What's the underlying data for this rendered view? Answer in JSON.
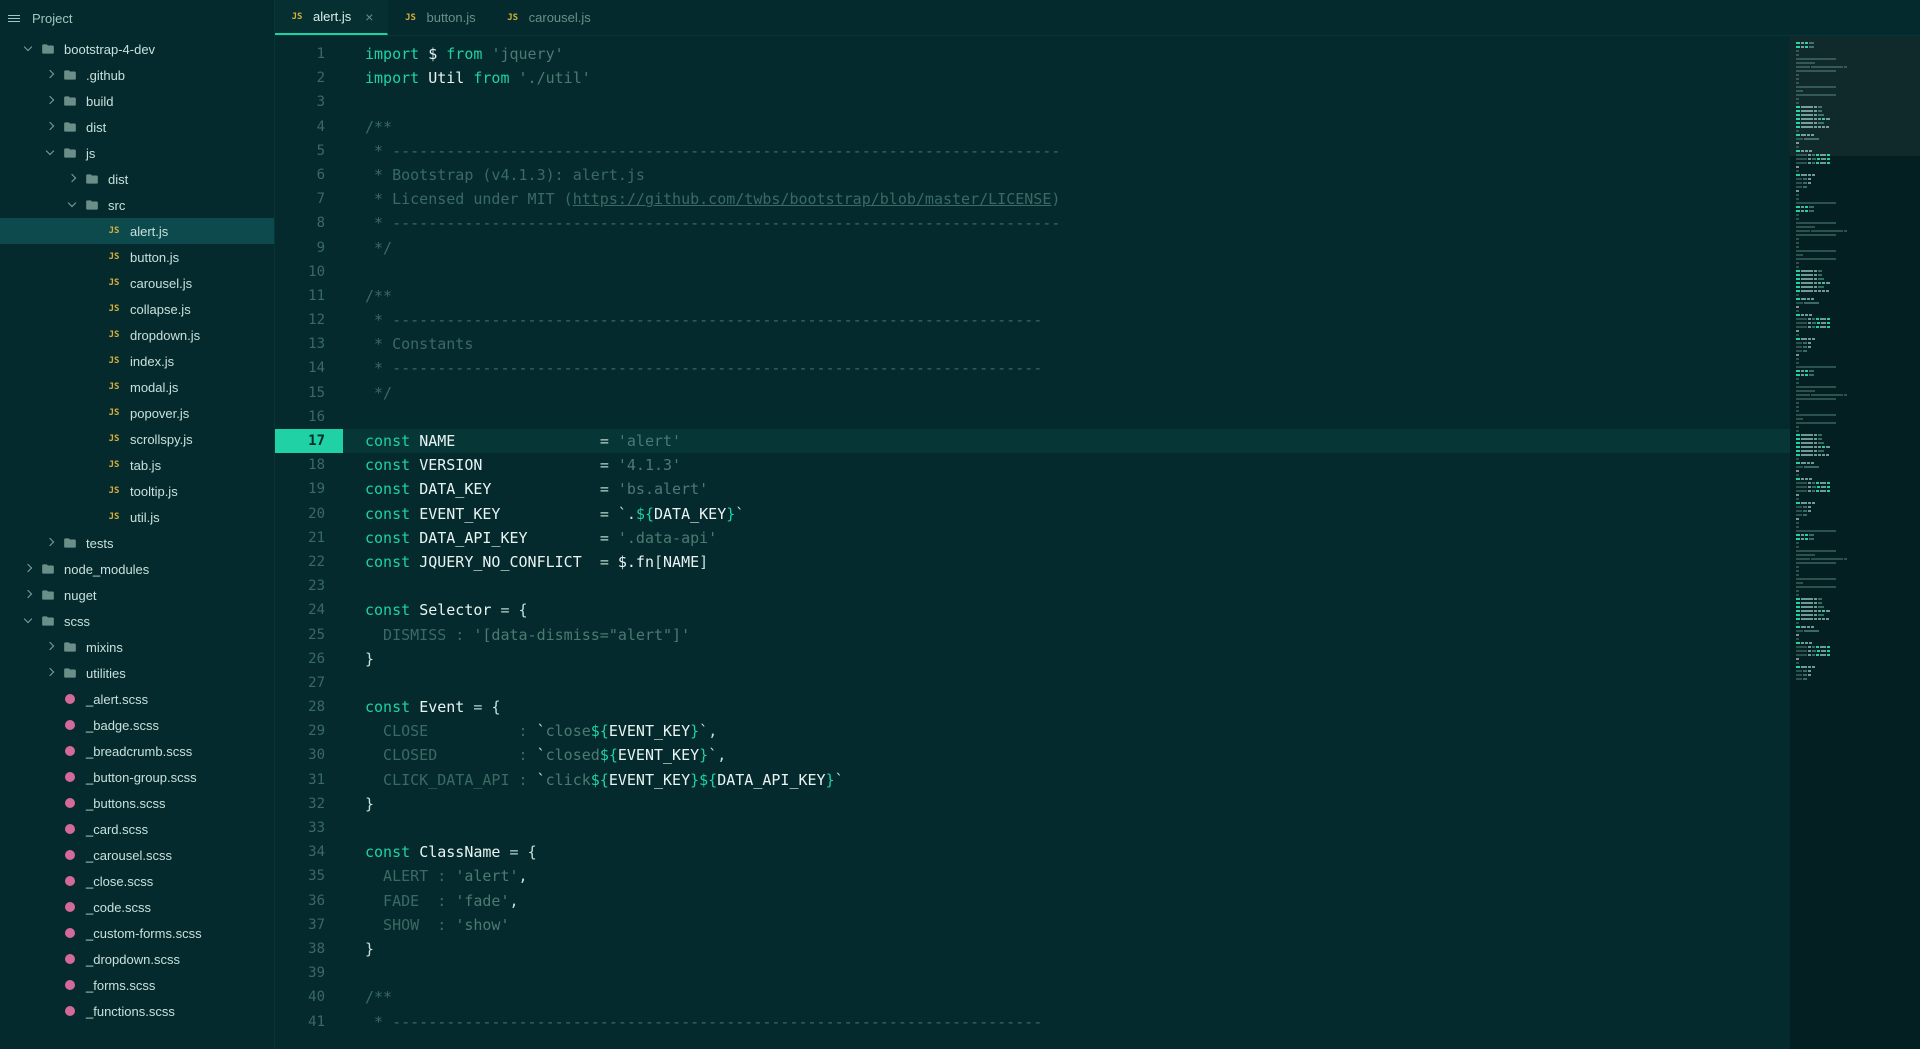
{
  "sidebar": {
    "header": "Project",
    "tree": [
      {
        "depth": 0,
        "kind": "folder",
        "expanded": true,
        "label": "bootstrap-4-dev"
      },
      {
        "depth": 1,
        "kind": "folder",
        "expanded": false,
        "label": ".github"
      },
      {
        "depth": 1,
        "kind": "folder",
        "expanded": false,
        "label": "build"
      },
      {
        "depth": 1,
        "kind": "folder",
        "expanded": false,
        "label": "dist"
      },
      {
        "depth": 1,
        "kind": "folder",
        "expanded": true,
        "label": "js"
      },
      {
        "depth": 2,
        "kind": "folder",
        "expanded": false,
        "label": "dist"
      },
      {
        "depth": 2,
        "kind": "folder",
        "expanded": true,
        "label": "src"
      },
      {
        "depth": 3,
        "kind": "js",
        "label": "alert.js",
        "selected": true
      },
      {
        "depth": 3,
        "kind": "js",
        "label": "button.js"
      },
      {
        "depth": 3,
        "kind": "js",
        "label": "carousel.js"
      },
      {
        "depth": 3,
        "kind": "js",
        "label": "collapse.js"
      },
      {
        "depth": 3,
        "kind": "js",
        "label": "dropdown.js"
      },
      {
        "depth": 3,
        "kind": "js",
        "label": "index.js"
      },
      {
        "depth": 3,
        "kind": "js",
        "label": "modal.js"
      },
      {
        "depth": 3,
        "kind": "js",
        "label": "popover.js"
      },
      {
        "depth": 3,
        "kind": "js",
        "label": "scrollspy.js"
      },
      {
        "depth": 3,
        "kind": "js",
        "label": "tab.js"
      },
      {
        "depth": 3,
        "kind": "js",
        "label": "tooltip.js"
      },
      {
        "depth": 3,
        "kind": "js",
        "label": "util.js"
      },
      {
        "depth": 1,
        "kind": "folder",
        "expanded": false,
        "label": "tests"
      },
      {
        "depth": 0,
        "kind": "folder",
        "expanded": false,
        "label": "node_modules"
      },
      {
        "depth": 0,
        "kind": "folder",
        "expanded": false,
        "label": "nuget"
      },
      {
        "depth": 0,
        "kind": "folder",
        "expanded": true,
        "label": "scss"
      },
      {
        "depth": 1,
        "kind": "folder",
        "expanded": false,
        "label": "mixins"
      },
      {
        "depth": 1,
        "kind": "folder",
        "expanded": false,
        "label": "utilities"
      },
      {
        "depth": 1,
        "kind": "scss",
        "label": "_alert.scss"
      },
      {
        "depth": 1,
        "kind": "scss",
        "label": "_badge.scss"
      },
      {
        "depth": 1,
        "kind": "scss",
        "label": "_breadcrumb.scss"
      },
      {
        "depth": 1,
        "kind": "scss",
        "label": "_button-group.scss"
      },
      {
        "depth": 1,
        "kind": "scss",
        "label": "_buttons.scss"
      },
      {
        "depth": 1,
        "kind": "scss",
        "label": "_card.scss"
      },
      {
        "depth": 1,
        "kind": "scss",
        "label": "_carousel.scss"
      },
      {
        "depth": 1,
        "kind": "scss",
        "label": "_close.scss"
      },
      {
        "depth": 1,
        "kind": "scss",
        "label": "_code.scss"
      },
      {
        "depth": 1,
        "kind": "scss",
        "label": "_custom-forms.scss"
      },
      {
        "depth": 1,
        "kind": "scss",
        "label": "_dropdown.scss"
      },
      {
        "depth": 1,
        "kind": "scss",
        "label": "_forms.scss"
      },
      {
        "depth": 1,
        "kind": "scss",
        "label": "_functions.scss"
      }
    ]
  },
  "tabs": [
    {
      "label": "alert.js",
      "active": true,
      "closeable": true
    },
    {
      "label": "button.js",
      "active": false
    },
    {
      "label": "carousel.js",
      "active": false
    }
  ],
  "editor": {
    "current_line": 17,
    "lines": [
      {
        "n": 1,
        "segs": [
          {
            "t": "import ",
            "c": "kw"
          },
          {
            "t": "$ ",
            "c": "var"
          },
          {
            "t": "from ",
            "c": "kw"
          },
          {
            "t": "'jquery'",
            "c": "str"
          }
        ]
      },
      {
        "n": 2,
        "segs": [
          {
            "t": "import ",
            "c": "kw"
          },
          {
            "t": "Util ",
            "c": "var"
          },
          {
            "t": "from ",
            "c": "kw"
          },
          {
            "t": "'./util'",
            "c": "str"
          }
        ]
      },
      {
        "n": 3,
        "segs": []
      },
      {
        "n": 4,
        "segs": [
          {
            "t": "/**",
            "c": "cmt"
          }
        ]
      },
      {
        "n": 5,
        "segs": [
          {
            "t": " * --------------------------------------------------------------------------",
            "c": "cmt"
          }
        ]
      },
      {
        "n": 6,
        "segs": [
          {
            "t": " * Bootstrap (v4.1.3): alert.js",
            "c": "cmt"
          }
        ]
      },
      {
        "n": 7,
        "segs": [
          {
            "t": " * Licensed under MIT (",
            "c": "cmt"
          },
          {
            "t": "https://github.com/twbs/bootstrap/blob/master/LICENSE",
            "c": "link"
          },
          {
            "t": ")",
            "c": "cmt"
          }
        ]
      },
      {
        "n": 8,
        "segs": [
          {
            "t": " * --------------------------------------------------------------------------",
            "c": "cmt"
          }
        ]
      },
      {
        "n": 9,
        "segs": [
          {
            "t": " */",
            "c": "cmt"
          }
        ]
      },
      {
        "n": 10,
        "segs": []
      },
      {
        "n": 11,
        "segs": [
          {
            "t": "/**",
            "c": "cmt"
          }
        ]
      },
      {
        "n": 12,
        "segs": [
          {
            "t": " * ------------------------------------------------------------------------",
            "c": "cmt"
          }
        ]
      },
      {
        "n": 13,
        "segs": [
          {
            "t": " * Constants",
            "c": "cmt"
          }
        ]
      },
      {
        "n": 14,
        "segs": [
          {
            "t": " * ------------------------------------------------------------------------",
            "c": "cmt"
          }
        ]
      },
      {
        "n": 15,
        "segs": [
          {
            "t": " */",
            "c": "cmt"
          }
        ]
      },
      {
        "n": 16,
        "segs": []
      },
      {
        "n": 17,
        "segs": [
          {
            "t": "const ",
            "c": "kw"
          },
          {
            "t": "NAME                ",
            "c": "var"
          },
          {
            "t": "= ",
            "c": "op"
          },
          {
            "t": "'alert'",
            "c": "str"
          }
        ]
      },
      {
        "n": 18,
        "segs": [
          {
            "t": "const ",
            "c": "kw"
          },
          {
            "t": "VERSION             ",
            "c": "var"
          },
          {
            "t": "= ",
            "c": "op"
          },
          {
            "t": "'4.1.3'",
            "c": "str"
          }
        ]
      },
      {
        "n": 19,
        "segs": [
          {
            "t": "const ",
            "c": "kw"
          },
          {
            "t": "DATA_KEY            ",
            "c": "var"
          },
          {
            "t": "= ",
            "c": "op"
          },
          {
            "t": "'bs.alert'",
            "c": "str"
          }
        ]
      },
      {
        "n": 20,
        "segs": [
          {
            "t": "const ",
            "c": "kw"
          },
          {
            "t": "EVENT_KEY           ",
            "c": "var"
          },
          {
            "t": "= ",
            "c": "op"
          },
          {
            "t": "`.",
            "c": "punct"
          },
          {
            "t": "${",
            "c": "tpl"
          },
          {
            "t": "DATA_KEY",
            "c": "var"
          },
          {
            "t": "}",
            "c": "tpl"
          },
          {
            "t": "`",
            "c": "punct"
          }
        ]
      },
      {
        "n": 21,
        "segs": [
          {
            "t": "const ",
            "c": "kw"
          },
          {
            "t": "DATA_API_KEY        ",
            "c": "var"
          },
          {
            "t": "= ",
            "c": "op"
          },
          {
            "t": "'.data-api'",
            "c": "str"
          }
        ]
      },
      {
        "n": 22,
        "segs": [
          {
            "t": "const ",
            "c": "kw"
          },
          {
            "t": "JQUERY_NO_CONFLICT  ",
            "c": "var"
          },
          {
            "t": "= ",
            "c": "op"
          },
          {
            "t": "$.fn",
            "c": "var"
          },
          {
            "t": "[",
            "c": "punct"
          },
          {
            "t": "NAME",
            "c": "var"
          },
          {
            "t": "]",
            "c": "punct"
          }
        ]
      },
      {
        "n": 23,
        "segs": []
      },
      {
        "n": 24,
        "segs": [
          {
            "t": "const ",
            "c": "kw"
          },
          {
            "t": "Selector ",
            "c": "var"
          },
          {
            "t": "= ",
            "c": "op"
          },
          {
            "t": "{",
            "c": "punct"
          }
        ]
      },
      {
        "n": 25,
        "segs": [
          {
            "t": "  DISMISS : ",
            "c": "cmt"
          },
          {
            "t": "'[data-dismiss=\"alert\"]'",
            "c": "str"
          }
        ]
      },
      {
        "n": 26,
        "segs": [
          {
            "t": "}",
            "c": "punct"
          }
        ]
      },
      {
        "n": 27,
        "segs": []
      },
      {
        "n": 28,
        "segs": [
          {
            "t": "const ",
            "c": "kw"
          },
          {
            "t": "Event ",
            "c": "var"
          },
          {
            "t": "= ",
            "c": "op"
          },
          {
            "t": "{",
            "c": "punct"
          }
        ]
      },
      {
        "n": 29,
        "segs": [
          {
            "t": "  CLOSE          : ",
            "c": "cmt"
          },
          {
            "t": "`",
            "c": "punct"
          },
          {
            "t": "close",
            "c": "str"
          },
          {
            "t": "${",
            "c": "tpl"
          },
          {
            "t": "EVENT_KEY",
            "c": "var"
          },
          {
            "t": "}",
            "c": "tpl"
          },
          {
            "t": "`",
            "c": "punct"
          },
          {
            "t": ",",
            "c": "punct"
          }
        ]
      },
      {
        "n": 30,
        "segs": [
          {
            "t": "  CLOSED         : ",
            "c": "cmt"
          },
          {
            "t": "`",
            "c": "punct"
          },
          {
            "t": "closed",
            "c": "str"
          },
          {
            "t": "${",
            "c": "tpl"
          },
          {
            "t": "EVENT_KEY",
            "c": "var"
          },
          {
            "t": "}",
            "c": "tpl"
          },
          {
            "t": "`",
            "c": "punct"
          },
          {
            "t": ",",
            "c": "punct"
          }
        ]
      },
      {
        "n": 31,
        "segs": [
          {
            "t": "  CLICK_DATA_API : ",
            "c": "cmt"
          },
          {
            "t": "`",
            "c": "punct"
          },
          {
            "t": "click",
            "c": "str"
          },
          {
            "t": "${",
            "c": "tpl"
          },
          {
            "t": "EVENT_KEY",
            "c": "var"
          },
          {
            "t": "}",
            "c": "tpl"
          },
          {
            "t": "${",
            "c": "tpl"
          },
          {
            "t": "DATA_API_KEY",
            "c": "var"
          },
          {
            "t": "}",
            "c": "tpl"
          },
          {
            "t": "`",
            "c": "punct"
          }
        ]
      },
      {
        "n": 32,
        "segs": [
          {
            "t": "}",
            "c": "punct"
          }
        ]
      },
      {
        "n": 33,
        "segs": []
      },
      {
        "n": 34,
        "segs": [
          {
            "t": "const ",
            "c": "kw"
          },
          {
            "t": "ClassName ",
            "c": "var"
          },
          {
            "t": "= ",
            "c": "op"
          },
          {
            "t": "{",
            "c": "punct"
          }
        ]
      },
      {
        "n": 35,
        "segs": [
          {
            "t": "  ALERT : ",
            "c": "cmt"
          },
          {
            "t": "'alert'",
            "c": "str"
          },
          {
            "t": ",",
            "c": "punct"
          }
        ]
      },
      {
        "n": 36,
        "segs": [
          {
            "t": "  FADE  : ",
            "c": "cmt"
          },
          {
            "t": "'fade'",
            "c": "str"
          },
          {
            "t": ",",
            "c": "punct"
          }
        ]
      },
      {
        "n": 37,
        "segs": [
          {
            "t": "  SHOW  : ",
            "c": "cmt"
          },
          {
            "t": "'show'",
            "c": "str"
          }
        ]
      },
      {
        "n": 38,
        "segs": [
          {
            "t": "}",
            "c": "punct"
          }
        ]
      },
      {
        "n": 39,
        "segs": []
      },
      {
        "n": 40,
        "segs": [
          {
            "t": "/**",
            "c": "cmt"
          }
        ]
      },
      {
        "n": 41,
        "segs": [
          {
            "t": " * ------------------------------------------------------------------------",
            "c": "cmt"
          }
        ]
      }
    ]
  }
}
